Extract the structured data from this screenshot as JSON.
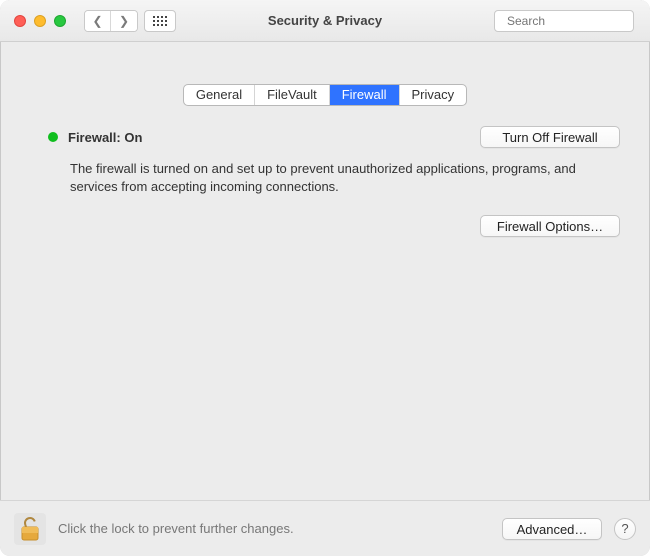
{
  "window": {
    "title": "Security & Privacy"
  },
  "search": {
    "placeholder": "Search"
  },
  "tabs": {
    "general": "General",
    "filevault": "FileVault",
    "firewall": "Firewall",
    "privacy": "Privacy",
    "active": "firewall"
  },
  "status": {
    "label": "Firewall: On",
    "color": "#0fbe1e"
  },
  "buttons": {
    "turn_off": "Turn Off Firewall",
    "options": "Firewall Options…",
    "advanced": "Advanced…",
    "help": "?"
  },
  "description": "The firewall is turned on and set up to prevent unauthorized applications, programs, and services from accepting incoming connections.",
  "footer": {
    "lock_hint": "Click the lock to prevent further changes."
  }
}
